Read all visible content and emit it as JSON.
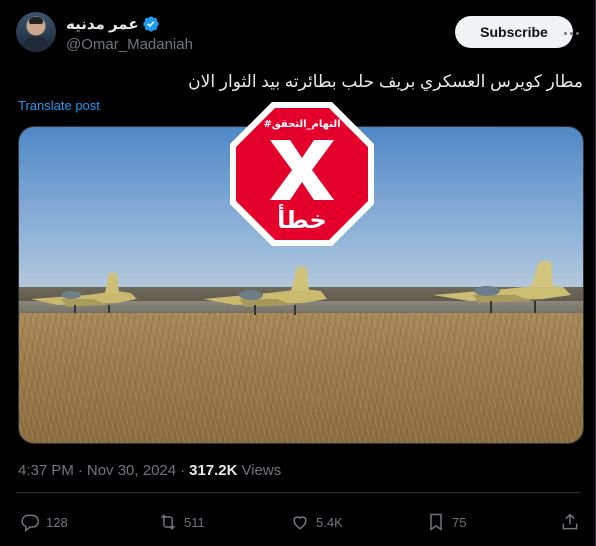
{
  "author": {
    "display_name": "عمر مدنيه",
    "handle": "@Omar_Madaniah",
    "verified": true
  },
  "subscribe_label": "Subscribe",
  "tweet_text": "مطار كويرس العسكري بريف حلب بطائرته بيد الثوار الان",
  "translate_label": "Translate post",
  "watermark": {
    "top_text": "#التهام_التحقق",
    "main_text": "خطأ",
    "color": "#e4002b"
  },
  "meta": {
    "time": "4:37 PM",
    "separator1": "·",
    "date": "Nov 30, 2024",
    "separator2": "·",
    "views_count": "317.2K",
    "views_label": "Views"
  },
  "actions": {
    "replies": "128",
    "reposts": "511",
    "likes": "5.4K",
    "bookmarks": "75"
  },
  "colors": {
    "background": "#000000",
    "text": "#e7e9ea",
    "muted": "#71767b",
    "link": "#1d9bf0",
    "verified": "#1d9bf0"
  }
}
